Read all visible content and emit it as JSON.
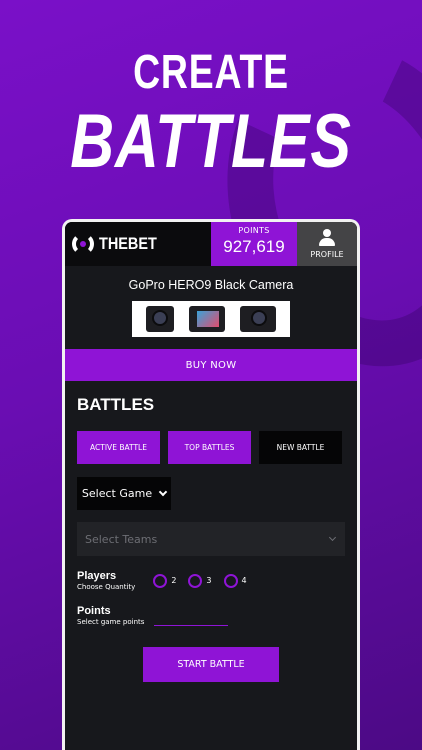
{
  "hero": {
    "line1": "CREATE",
    "line2": "BATTLES"
  },
  "app": {
    "brand": "THEBET",
    "points_label": "POINTS",
    "points_value": "927,619",
    "profile_label": "PROFILE",
    "product_title": "GoPro HERO9 Black Camera",
    "buy_label": "BUY NOW",
    "section_title": "BATTLES",
    "tabs": [
      {
        "label": "ACTIVE BATTLE"
      },
      {
        "label": "TOP BATTLES"
      },
      {
        "label": "NEW BATTLE"
      }
    ],
    "select_game": "Select Game",
    "select_teams_placeholder": "Select Teams",
    "players_label": "Players",
    "players_sub": "Choose Quantity",
    "player_options": [
      "2",
      "3",
      "4"
    ],
    "points_field_label": "Points",
    "points_field_sub": "Select game points",
    "start_label": "START BATTLE"
  },
  "colors": {
    "accent": "#8f14d6",
    "panel": "#17181c",
    "background": "#6a0db3"
  },
  "icons": [
    "thebet-logo-icon",
    "profile-icon",
    "chevron-down-icon"
  ]
}
